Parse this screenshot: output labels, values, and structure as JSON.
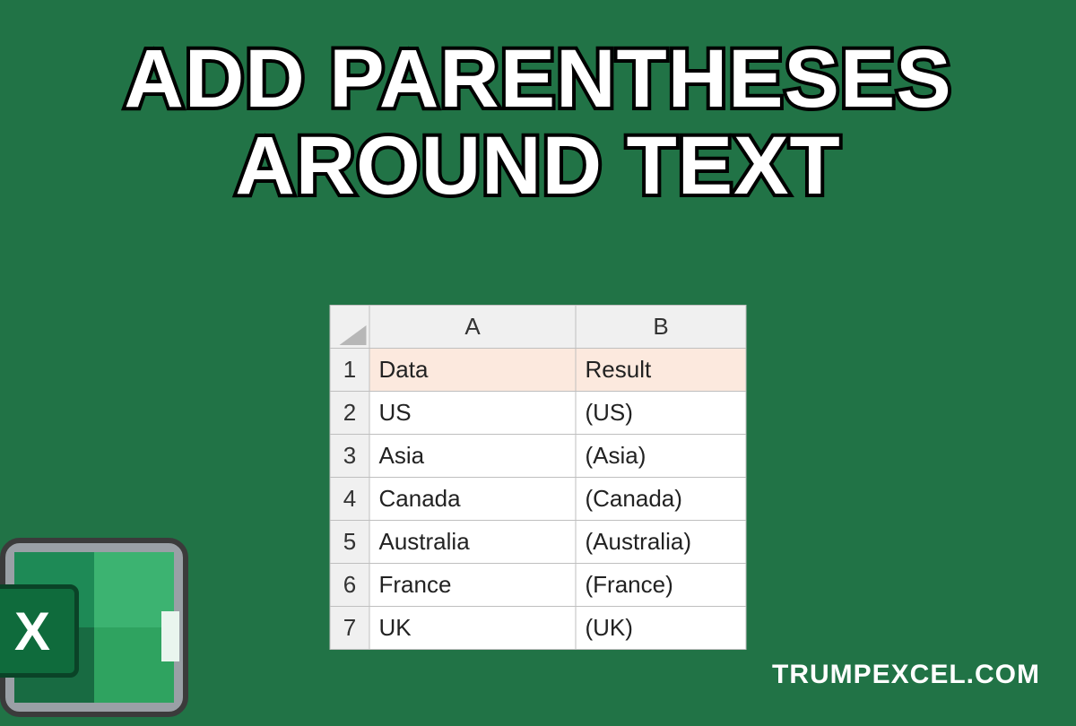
{
  "title": {
    "line1": "ADD PARENTHESES",
    "line2": "AROUND TEXT"
  },
  "spreadsheet": {
    "columns": [
      "A",
      "B"
    ],
    "header_row": {
      "data": "Data",
      "result": "Result"
    },
    "rows": [
      {
        "n": "1",
        "a": "Data",
        "b": "Result"
      },
      {
        "n": "2",
        "a": "US",
        "b": "(US)"
      },
      {
        "n": "3",
        "a": "Asia",
        "b": "(Asia)"
      },
      {
        "n": "4",
        "a": "Canada",
        "b": "(Canada)"
      },
      {
        "n": "5",
        "a": "Australia",
        "b": "(Australia)"
      },
      {
        "n": "6",
        "a": "France",
        "b": "(France)"
      },
      {
        "n": "7",
        "a": "UK",
        "b": "(UK)"
      }
    ]
  },
  "logo": {
    "letter": "X"
  },
  "watermark": "TRUMPEXCEL.COM"
}
